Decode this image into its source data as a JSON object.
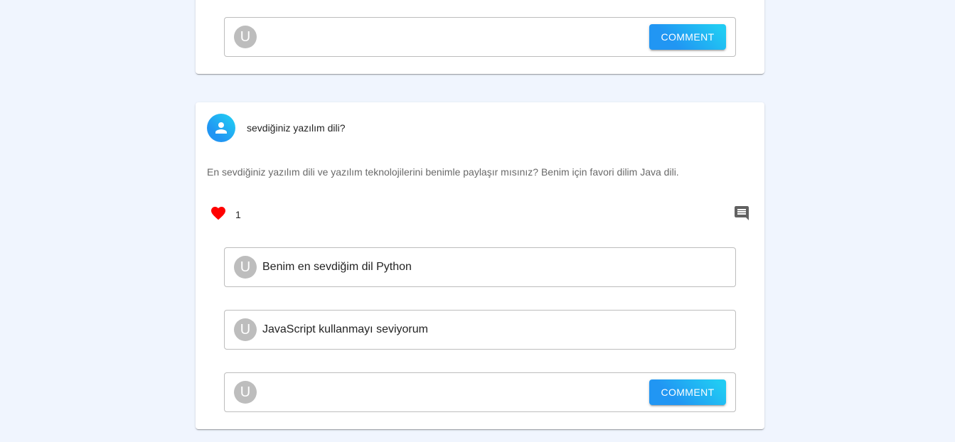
{
  "top_card": {
    "avatar_letter": "U",
    "button_label": "COMMENT"
  },
  "post": {
    "title": "sevdiğiniz yazılım dili?",
    "text": "En sevdiğiniz yazılım dili ve yazılım teknolojilerini benimle paylaşır mısınız? Benim için favori dilim Java dili.",
    "like_count": "1",
    "liked": true,
    "like_color": "#ff0000",
    "avatar_icon": "person-icon",
    "comments": [
      {
        "avatar_letter": "U",
        "text": "Benim en sevdiğim dil Python"
      },
      {
        "avatar_letter": "U",
        "text": "JavaScript kullanmayı seviyorum"
      }
    ],
    "new_comment": {
      "avatar_letter": "U",
      "button_label": "COMMENT"
    }
  },
  "colors": {
    "background": "#f0f5fe",
    "accent_start": "#2196F3",
    "accent_end": "#21CBF3"
  }
}
